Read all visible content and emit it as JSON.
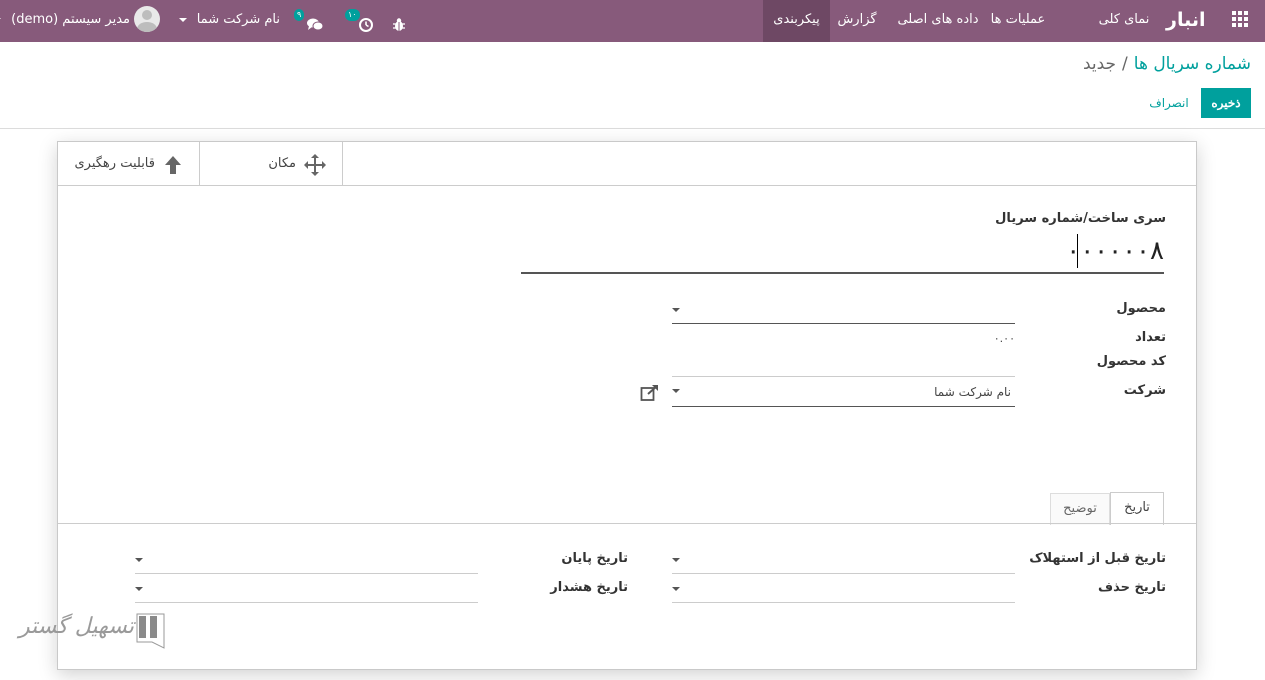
{
  "navbar": {
    "brand": "انبار",
    "menu": [
      "نمای کلی",
      "عملیات ها",
      "داده های اصلی",
      "گزارش",
      "پیکربندی"
    ],
    "company": "نام شرکت شما",
    "user": "مدیر سیستم (demo)",
    "messages_count": "۹",
    "activities_count": "۱۰",
    "icons": [
      "apps-icon",
      "bug-icon",
      "clock-icon",
      "chat-icon",
      "avatar"
    ],
    "bg_color": "#875a7b"
  },
  "breadcrumb": {
    "parent": "شماره سریال ها",
    "separator": "/",
    "current": "جدید"
  },
  "buttons": {
    "save": "ذخیره",
    "discard": "انصراف",
    "accent_color": "#00a09d"
  },
  "smart_buttons": [
    {
      "label": "قابلیت رهگیری",
      "icon": "arrow-up-icon"
    },
    {
      "label": "مکان",
      "icon": "move-arrows-icon"
    }
  ],
  "form": {
    "serial_label": "سری ساخت/شماره سریال",
    "serial_value": "۰۰۰۰۰۰۸",
    "product_label": "محصول",
    "product_value": "",
    "quantity_label": "تعداد",
    "quantity_value": "۰.۰۰",
    "product_code_label": "کد محصول",
    "company_label": "شرکت",
    "company_value": "نام شرکت شما"
  },
  "tabs": [
    {
      "label": "تاریخ",
      "active": true
    },
    {
      "label": "توضیح",
      "active": false
    }
  ],
  "dates": {
    "best_before_label": "تاریخ قبل از استهلاک",
    "removal_label": "تاریخ حذف",
    "end_label": "تاریخ پایان",
    "alert_label": "تاریخ هشدار"
  },
  "watermark": "تسهیل گستر"
}
